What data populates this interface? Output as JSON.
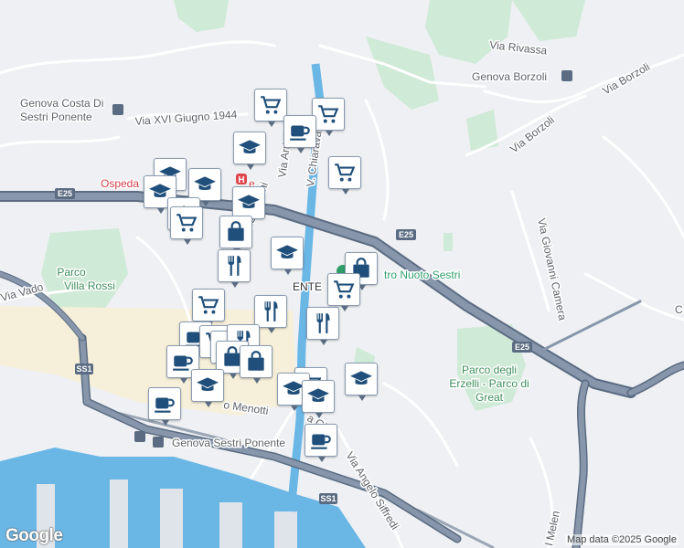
{
  "map": {
    "colors": {
      "land": "#eef0f3",
      "park": "#cfead6",
      "water": "#6ab7e6",
      "road": "#ffffff",
      "highway": "#8796ab",
      "highway_casing": "#5b6c82",
      "urban": "#f6efd9",
      "pin_icon": "#1f4f7a"
    },
    "labels": {
      "genova_costa": "Genova Costa Di",
      "sestri_ponente_line": "Sestri Ponente",
      "via_xvi_giugno": "Via XVI Giugno 1944",
      "ospedale": "Ospeda",
      "ospedale_suffix": "e",
      "e25_west": "E25",
      "e25_mid": "E25",
      "e25_east": "E25",
      "v_chiaravagna": "V. Chiaravagna",
      "via_arrivabene": "Via Arrivabe",
      "via_giovanni": "Via Giovanni",
      "parco_villa_rossi_1": "Parco",
      "parco_villa_rossi_2": "Villa Rossi",
      "via_vado": "Via Vado",
      "sestri_center": "ENTE",
      "centro_nuoto": "tro Nuoto Sestri",
      "ss1_west": "SS1",
      "ss1_south": "SS1",
      "via_menotti": "o Menotti",
      "via_gio": "a Gio",
      "station": "Genova Sestri Ponente",
      "via_angelo_siffredi": "Via Angelo Siffredi",
      "via_rivassa": "Via Rivassa",
      "genova_borzoli": "Genova Borzoli",
      "via_borzoli_ne": "Via Borzoli",
      "via_borzoli": "Via Borzoli",
      "via_giovanni_camera": "Via Giovanni Camera",
      "parco_erzelli_1": "Parco degli",
      "parco_erzelli_2": "Erzelli - Parco di",
      "parco_erzelli_3": "Great",
      "via_melen": "l Melen",
      "edge_c": "C"
    },
    "pins": [
      {
        "type": "shopping-cart"
      },
      {
        "type": "shopping-cart"
      },
      {
        "type": "coffee-cup"
      },
      {
        "type": "graduation-cap"
      },
      {
        "type": "shopping-cart"
      },
      {
        "type": "graduation-cap"
      },
      {
        "type": "graduation-cap"
      },
      {
        "type": "graduation-cap"
      },
      {
        "type": "graduation-cap"
      },
      {
        "type": "graduation-cap"
      },
      {
        "type": "shopping-cart"
      },
      {
        "type": "shopping-bag"
      },
      {
        "type": "graduation-cap"
      },
      {
        "type": "shopping-bag"
      },
      {
        "type": "fork-knife"
      },
      {
        "type": "shopping-cart"
      },
      {
        "type": "shopping-cart"
      },
      {
        "type": "fork-knife"
      },
      {
        "type": "fork-knife"
      },
      {
        "type": "coffee-cup"
      },
      {
        "type": "shopping-cart"
      },
      {
        "type": "coffee-cup"
      },
      {
        "type": "fork-knife"
      },
      {
        "type": "shopping-bag"
      },
      {
        "type": "shopping-bag"
      },
      {
        "type": "coffee-cup"
      },
      {
        "type": "graduation-cap"
      },
      {
        "type": "coffee-cup"
      },
      {
        "type": "shopping-cart"
      },
      {
        "type": "graduation-cap"
      },
      {
        "type": "graduation-cap"
      },
      {
        "type": "graduation-cap"
      },
      {
        "type": "coffee-cup"
      }
    ]
  },
  "footer": {
    "logo": "Google",
    "attribution": "Map data ©2025 Google"
  }
}
